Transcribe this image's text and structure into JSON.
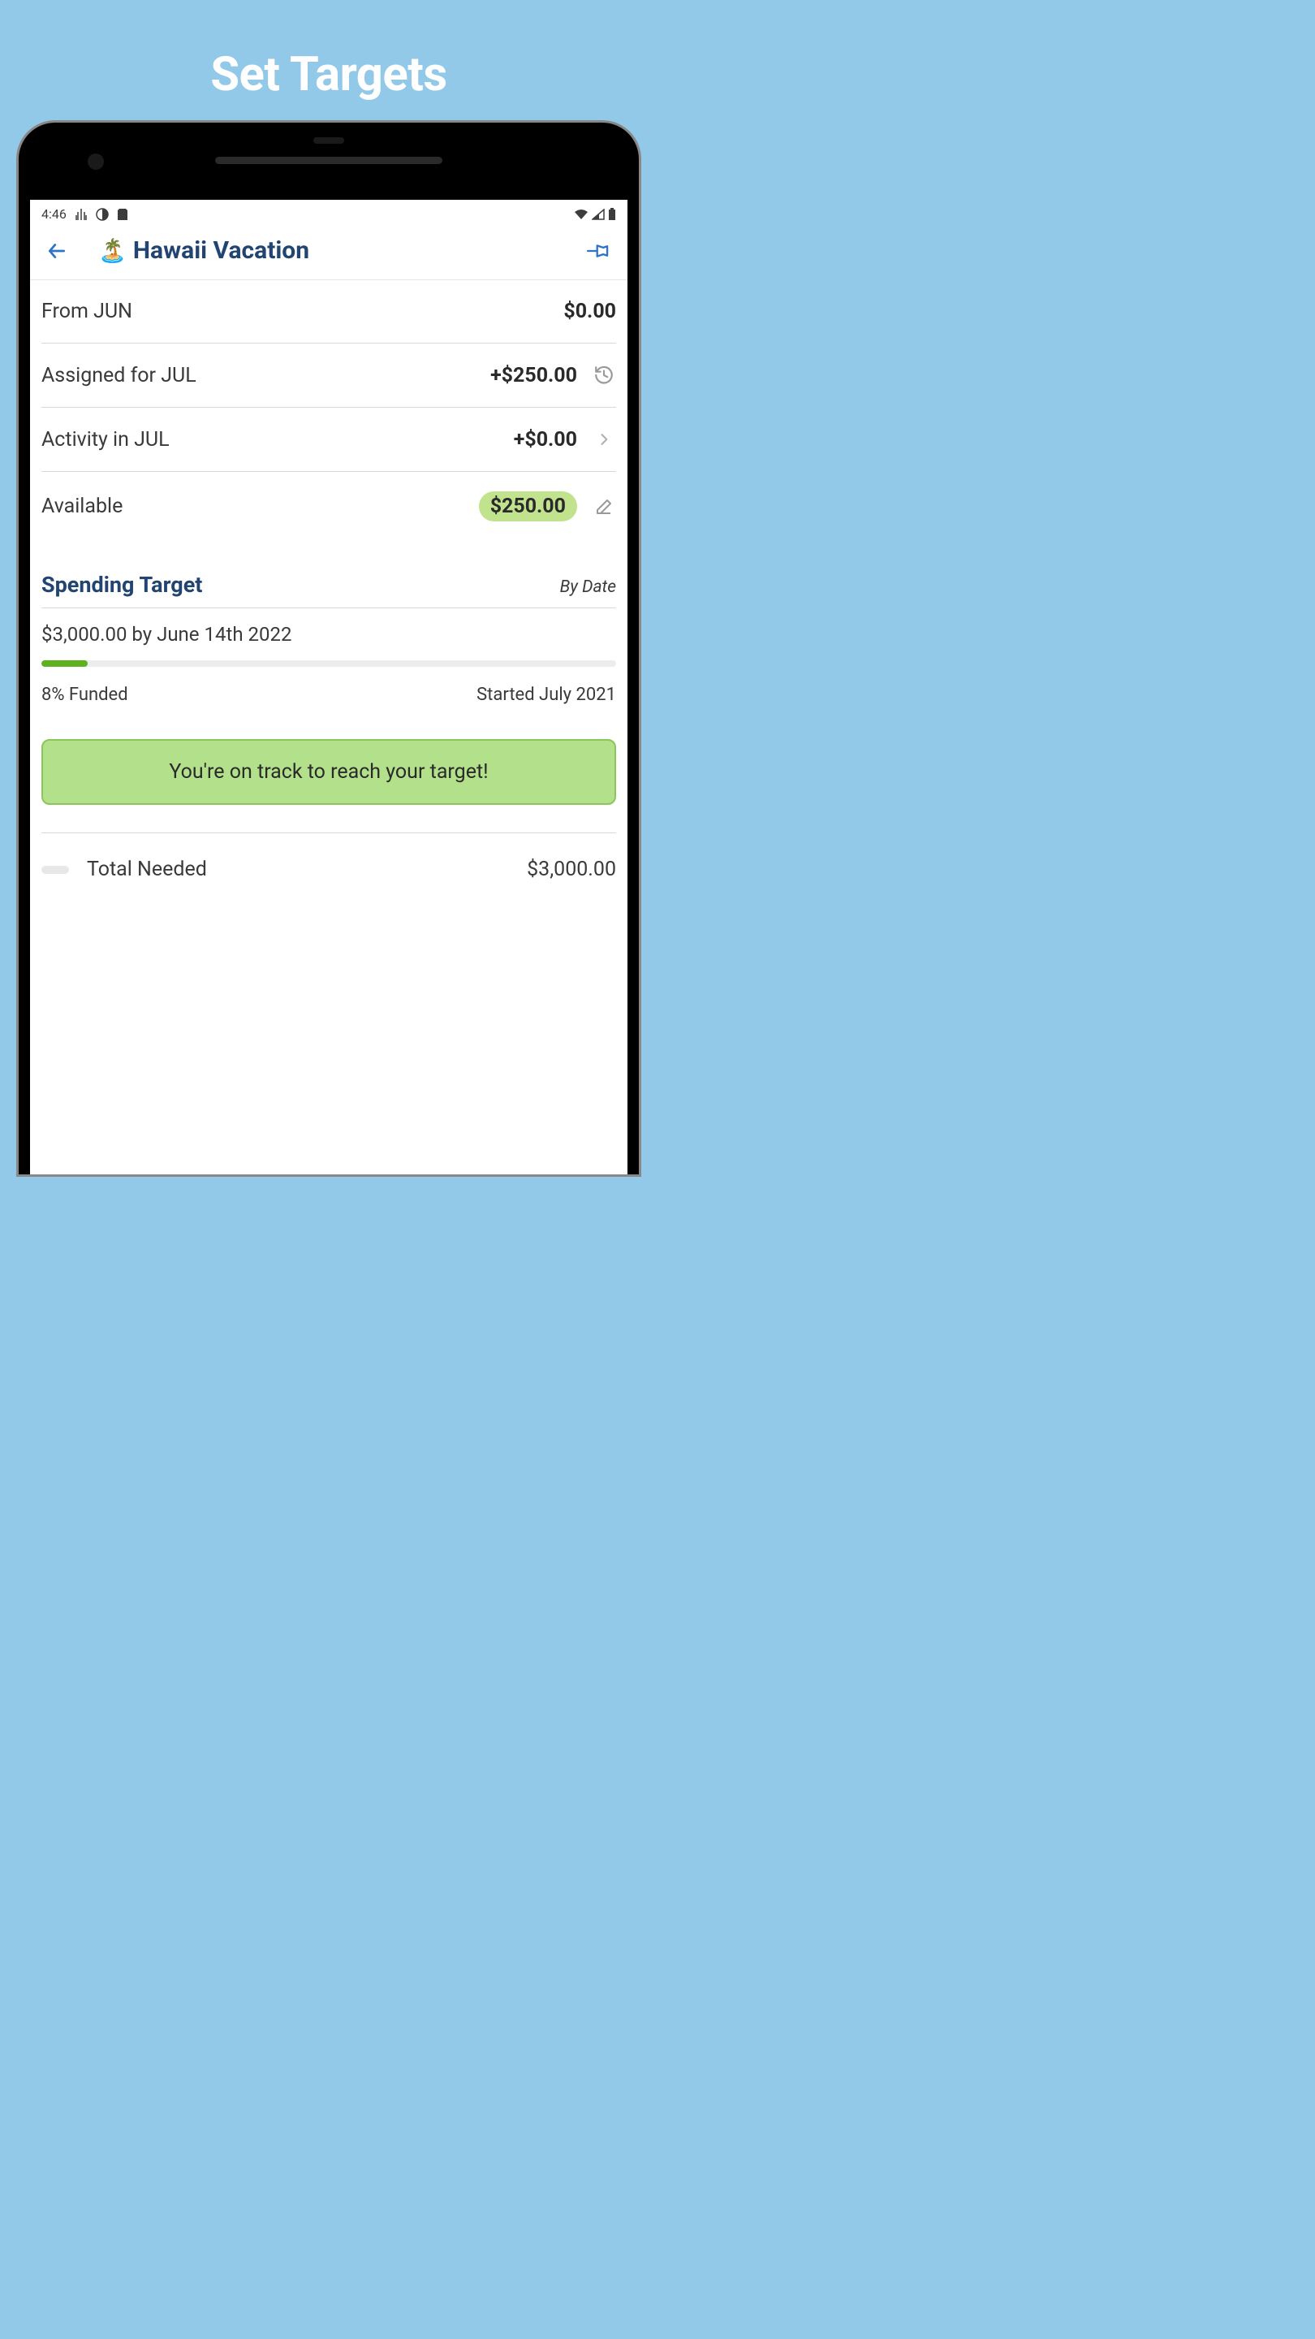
{
  "marketing": {
    "title": "Set Targets"
  },
  "status_bar": {
    "time": "4:46"
  },
  "header": {
    "emoji": "🏝️",
    "title": "Hawaii Vacation"
  },
  "summary": {
    "from": {
      "label": "From JUN",
      "value": "$0.00"
    },
    "assigned": {
      "label": "Assigned for JUL",
      "value": "+$250.00"
    },
    "activity": {
      "label": "Activity in JUL",
      "value": "+$0.00"
    },
    "available": {
      "label": "Available",
      "value": "$250.00"
    }
  },
  "target": {
    "section_title": "Spending Target",
    "by_date_label": "By Date",
    "goal_text": "$3,000.00 by June 14th 2022",
    "progress_percent": 8,
    "funded_text": "8% Funded",
    "started_text": "Started July 2021",
    "on_track_message": "You're on track to reach your target!"
  },
  "totals": {
    "needed": {
      "label": "Total Needed",
      "value": "$3,000.00"
    }
  }
}
